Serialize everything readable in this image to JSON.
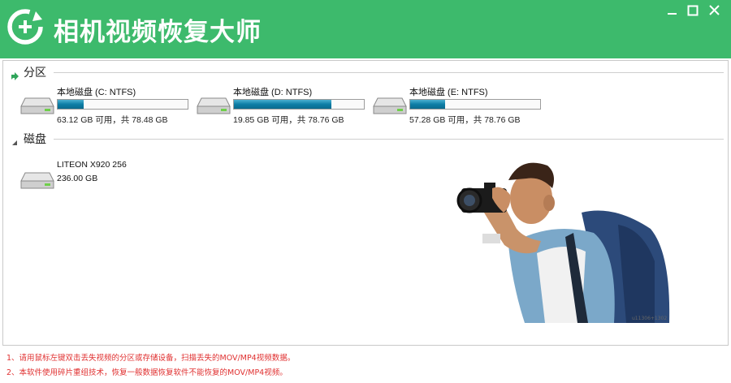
{
  "app": {
    "title": "相机视频恢复大师"
  },
  "window_controls": {
    "minimize": "minimize",
    "maximize": "maximize",
    "close": "close"
  },
  "partitions": {
    "title": "分区",
    "drives": [
      {
        "name": "本地磁盘 (C: NTFS)",
        "used_fraction": 0.2,
        "info": "63.12 GB 可用，共 78.48 GB"
      },
      {
        "name": "本地磁盘 (D: NTFS)",
        "used_fraction": 0.75,
        "info": "19.85 GB 可用，共 78.76 GB"
      },
      {
        "name": "本地磁盘 (E: NTFS)",
        "used_fraction": 0.27,
        "info": "57.28 GB 可用，共 78.76 GB"
      }
    ]
  },
  "disks": {
    "title": "磁盘",
    "items": [
      {
        "name": "LITEON X920 256",
        "size": "236.00 GB"
      }
    ]
  },
  "notes": [
    "1、请用鼠标左键双击丢失视频的分区或存储设备，扫描丢失的MOV/MP4视频数据。",
    "2、本软件使用碎片重组技术，恢复一般数据恢复软件不能恢复的MOV/MP4视频。"
  ],
  "colors": {
    "titlebar": "#3dba6c",
    "bar_fill": "#0e7ea6",
    "note_text": "#e03030"
  },
  "icons": [
    "logo-icon",
    "drive-icon",
    "photographer-illustration"
  ]
}
